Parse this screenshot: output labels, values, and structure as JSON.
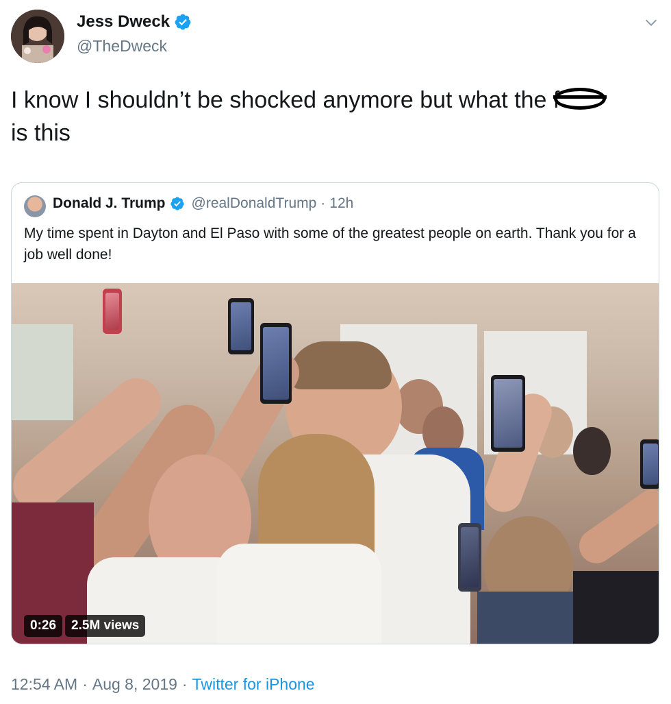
{
  "author": {
    "display_name": "Jess Dweck",
    "handle": "@TheDweck",
    "verified": true,
    "avatar_icon": "avatar-photo"
  },
  "tweet": {
    "text_line1": "I know I shouldn’t be shocked anymore but what the f",
    "text_line2": "is this",
    "redaction_icon": "scribble-redaction-icon"
  },
  "quoted_tweet": {
    "display_name": "Donald J. Trump",
    "handle": "@realDonaldTrump",
    "separator": "·",
    "age": "12h",
    "verified": true,
    "text": "My time spent in Dayton and El Paso with some of the greatest people on earth. Thank you for a job well done!",
    "video": {
      "duration": "0:26",
      "views": "2.5M views"
    }
  },
  "footer": {
    "time": "12:54 AM",
    "sep1": "·",
    "date": "Aug 8, 2019",
    "sep2": "·",
    "source": "Twitter for iPhone"
  },
  "colors": {
    "verified_blue": "#1da1f2",
    "link_blue": "#1b95e0",
    "secondary_text": "#657786",
    "border": "#ccd6dd"
  }
}
